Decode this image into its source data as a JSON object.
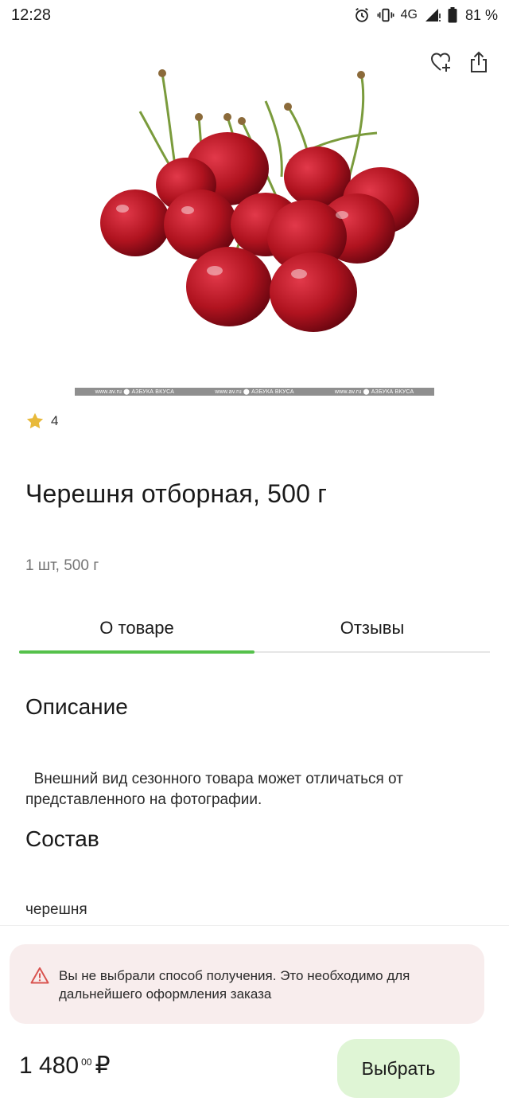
{
  "status_bar": {
    "time": "12:28",
    "network": "4G",
    "battery": "81 %"
  },
  "product": {
    "rating": "4",
    "title": "Черешня отборная, 500 г",
    "subtitle": "1 шт, 500 г",
    "watermark": [
      "www.av.ru ⬤ АЗБУКА ВКУСА",
      "www.av.ru ⬤ АЗБУКА ВКУСА",
      "www.av.ru ⬤ АЗБУКА ВКУСА"
    ]
  },
  "tabs": [
    {
      "label": "О товаре",
      "active": true
    },
    {
      "label": "Отзывы",
      "active": false
    }
  ],
  "description": {
    "title": "Описание",
    "text": "  Внешний вид сезонного товара может отличаться от представленного на фотографии."
  },
  "composition": {
    "title": "Состав",
    "text": "черешня"
  },
  "warning": {
    "text": "Вы не выбрали способ получения. Это необходимо для дальнейшего оформления заказа"
  },
  "price": {
    "main": "1 480",
    "kopecks": "00",
    "currency": "₽"
  },
  "actions": {
    "select_label": "Выбрать"
  },
  "colors": {
    "accent": "#55c14b",
    "button_bg": "#dff5d5",
    "warning_bg": "#f8eded",
    "warning_icon": "#d9534f",
    "star": "#e8b93a"
  },
  "icons": [
    "alarm-icon",
    "vibrate-icon",
    "signal-icon",
    "battery-icon",
    "favorite-add-icon",
    "share-icon",
    "star-icon",
    "warning-icon"
  ]
}
